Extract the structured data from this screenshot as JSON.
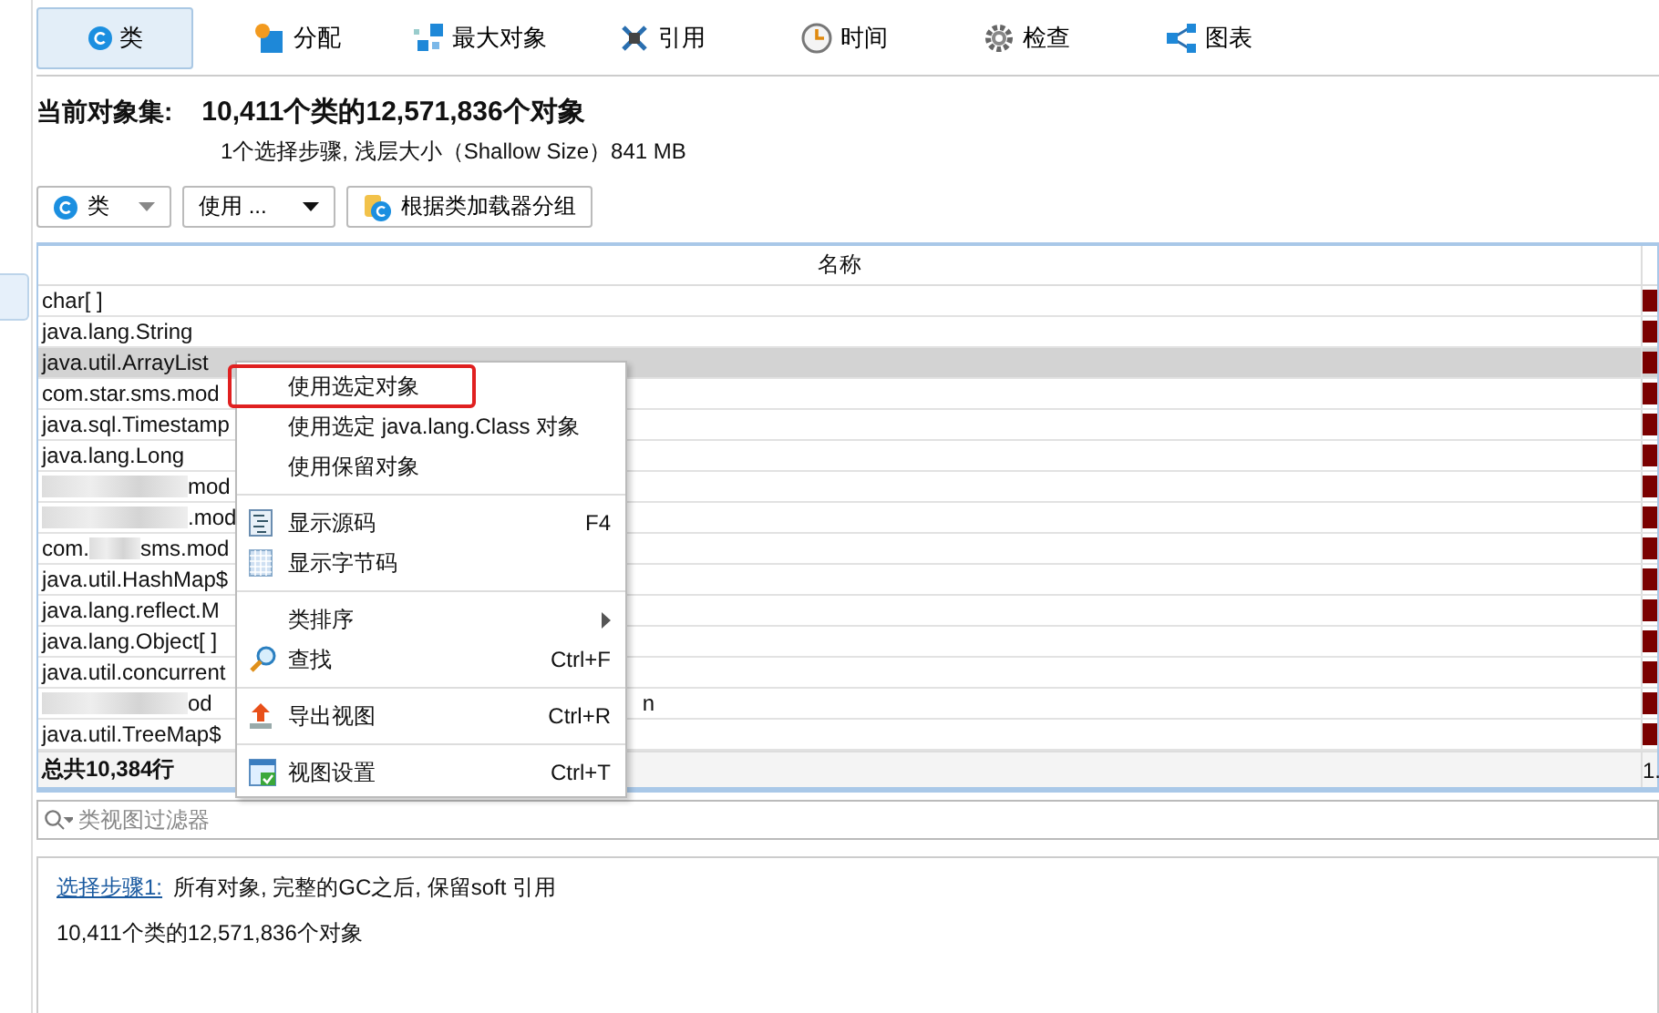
{
  "tabs": [
    {
      "label": "类",
      "selected": true
    },
    {
      "label": "分配",
      "selected": false
    },
    {
      "label": "最大对象",
      "selected": false
    },
    {
      "label": "引用",
      "selected": false
    },
    {
      "label": "时间",
      "selected": false
    },
    {
      "label": "检查",
      "selected": false
    },
    {
      "label": "图表",
      "selected": false
    }
  ],
  "summary": {
    "label": "当前对象集:",
    "value": "10,411个类的12,571,836个对象",
    "detail": "1个选择步骤, 浅层大小（Shallow Size）841 MB"
  },
  "toolbar": [
    {
      "kind": "class-dropdown",
      "label": "类"
    },
    {
      "kind": "dropdown",
      "label": "使用 ..."
    },
    {
      "kind": "loader",
      "label": "根据类加载器分组"
    }
  ],
  "table": {
    "columns": [
      "名称"
    ],
    "rows": [
      {
        "kind": "plain",
        "name": "char[ ]",
        "selected": false
      },
      {
        "kind": "plain",
        "name": "java.lang.String",
        "selected": false
      },
      {
        "kind": "plain",
        "name": "java.util.ArrayList",
        "selected": true
      },
      {
        "kind": "plain",
        "name": "com.star.sms.mod",
        "selected": false
      },
      {
        "kind": "plain",
        "name": "java.sql.Timestamp",
        "selected": false
      },
      {
        "kind": "plain",
        "name": "java.lang.Long",
        "selected": false
      },
      {
        "kind": "redacted",
        "prefix": "",
        "name": "mod",
        "selected": false
      },
      {
        "kind": "redacted",
        "prefix": "",
        "name": ".mod",
        "selected": false
      },
      {
        "kind": "redacted",
        "prefix": "com.",
        "name": "sms.mod",
        "selected": false
      },
      {
        "kind": "plain",
        "name": "java.util.HashMap$",
        "selected": false
      },
      {
        "kind": "plain",
        "name": "java.lang.reflect.M",
        "selected": false
      },
      {
        "kind": "plain",
        "name": "java.lang.Object[ ]",
        "selected": false
      },
      {
        "kind": "plain",
        "name": "java.util.concurrent",
        "selected": false
      },
      {
        "kind": "redacted",
        "prefix": "",
        "name": "od",
        "tail": "n",
        "selected": false
      },
      {
        "kind": "plain",
        "name": "java.util.TreeMap$",
        "selected": false
      }
    ],
    "total": "总共10,384行",
    "total_column_2": "1."
  },
  "filter": {
    "placeholder": "类视图过滤器"
  },
  "details": {
    "link": "选择步骤1:",
    "text": "所有对象, 完整的GC之后, 保留soft 引用",
    "count": "10,411个类的12,571,836个对象"
  },
  "context_menu": [
    {
      "kind": "item",
      "label": "使用选定对象",
      "highlighted": true
    },
    {
      "kind": "item",
      "label": "使用选定 java.lang.Class 对象",
      "highlighted": false
    },
    {
      "kind": "item",
      "label": "使用保留对象",
      "highlighted": false
    },
    {
      "kind": "separator"
    },
    {
      "kind": "item",
      "label": "显示源码",
      "shortcut": "F4",
      "highlighted": false
    },
    {
      "kind": "item",
      "label": "显示字节码",
      "highlighted": false
    },
    {
      "kind": "separator"
    },
    {
      "kind": "submenu",
      "label": "类排序",
      "highlighted": false
    },
    {
      "kind": "item",
      "label": "查找",
      "shortcut": "Ctrl+F",
      "highlighted": false
    },
    {
      "kind": "separator"
    },
    {
      "kind": "item",
      "label": "导出视图",
      "shortcut": "Ctrl+R",
      "highlighted": false
    },
    {
      "kind": "separator"
    },
    {
      "kind": "item",
      "label": "视图设置",
      "shortcut": "Ctrl+T",
      "highlighted": false
    }
  ]
}
